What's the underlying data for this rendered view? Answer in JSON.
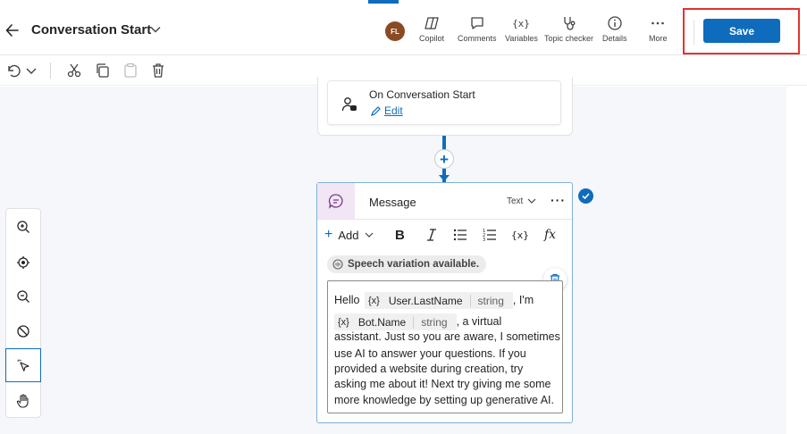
{
  "header": {
    "title": "Conversation Start",
    "avatar_initials": "FL",
    "tools": [
      {
        "label": "Copilot",
        "icon": "copilot-icon"
      },
      {
        "label": "Comments",
        "icon": "comment-icon"
      },
      {
        "label": "Variables",
        "icon": "variables-icon"
      },
      {
        "label": "Topic checker",
        "icon": "stethoscope-icon"
      },
      {
        "label": "Details",
        "icon": "info-icon"
      },
      {
        "label": "More",
        "icon": "more-icon"
      }
    ],
    "save_label": "Save"
  },
  "toolbar": {
    "icons": [
      "undo-icon",
      "chevron-down-icon",
      "cut-icon",
      "copy-icon",
      "paste-icon",
      "delete-icon"
    ]
  },
  "trigger": {
    "title": "On Conversation Start",
    "edit_label": "Edit"
  },
  "message": {
    "title": "Message",
    "type_label": "Text",
    "add_label": "Add",
    "speech_label": "Speech variation available.",
    "text": {
      "before_var1": "Hello",
      "var1": {
        "icon": "{x}",
        "name": "User.LastName",
        "type": "string"
      },
      "after_var1": ", I'm",
      "var2": {
        "icon": "{x}",
        "name": "Bot.Name",
        "type": "string"
      },
      "after_var2": ", a virtual",
      "lines": [
        "assistant. Just so you are aware, I sometimes",
        "use AI to answer your questions. If you",
        "provided a website during creation, try",
        "asking me about it! Next try giving me some",
        "more knowledge by setting up generative AI."
      ]
    }
  },
  "colors": {
    "accent": "#0f6cbd",
    "highlight": "#e3342f",
    "avatar": "#8a4a25"
  }
}
